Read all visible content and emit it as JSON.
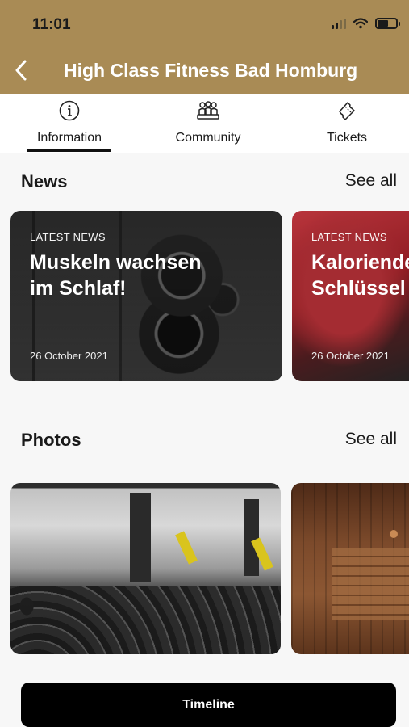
{
  "status_bar": {
    "time": "11:01"
  },
  "header": {
    "title": "High Class Fitness Bad Homburg"
  },
  "tabs": [
    {
      "label": "Information",
      "icon": "info-icon",
      "active": true
    },
    {
      "label": "Community",
      "icon": "community-icon",
      "active": false
    },
    {
      "label": "Tickets",
      "icon": "ticket-icon",
      "active": false
    }
  ],
  "news": {
    "title": "News",
    "see_all": "See all",
    "items": [
      {
        "tag": "LATEST NEWS",
        "headline": "Muskeln wachsen\nim Schlaf!",
        "date": "26 October 2021"
      },
      {
        "tag": "LATEST NEWS",
        "headline": "Kaloriende\nSchlüssel",
        "date": "26 October 2021"
      }
    ]
  },
  "photos": {
    "title": "Photos",
    "see_all": "See all"
  },
  "timeline_button": {
    "label": "Timeline"
  },
  "colors": {
    "header_bg": "#a98b55",
    "accent": "#111111",
    "button_bg": "#000000"
  }
}
